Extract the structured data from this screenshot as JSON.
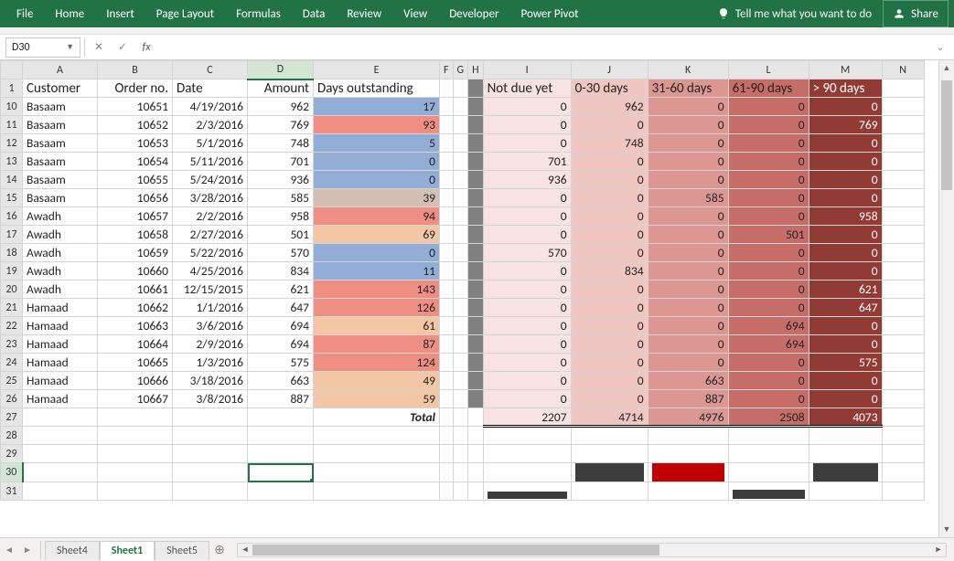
{
  "ribbon": {
    "tabs": [
      "File",
      "Home",
      "Insert",
      "Page Layout",
      "Formulas",
      "Data",
      "Review",
      "View",
      "Developer",
      "Power Pivot"
    ],
    "tellme": "Tell me what you want to do",
    "share": "Share"
  },
  "namebox": "D30",
  "cols": [
    "A",
    "B",
    "C",
    "D",
    "E",
    "F",
    "G",
    "H",
    "I",
    "J",
    "K",
    "L",
    "M",
    "N"
  ],
  "header_row": 1,
  "headers": {
    "A": "Customer",
    "B": "Order no.",
    "C": "Date",
    "D": "Amount",
    "E": "Days outstanding",
    "I": "Not due yet",
    "J": "0-30 days",
    "K": "31-60 days",
    "L": "61-90 days",
    "M": "> 90 days"
  },
  "rows": [
    {
      "n": 10,
      "A": "Basaam",
      "B": 10651,
      "C": "4/19/2016",
      "D": 962,
      "E": 17,
      "Ec": "e_low",
      "I": 0,
      "J": 962,
      "K": 0,
      "L": 0,
      "M": 0
    },
    {
      "n": 11,
      "A": "Basaam",
      "B": 10652,
      "C": "2/3/2016",
      "D": 769,
      "E": 93,
      "Ec": "e_high",
      "I": 0,
      "J": 0,
      "K": 0,
      "L": 0,
      "M": 769
    },
    {
      "n": 12,
      "A": "Basaam",
      "B": 10653,
      "C": "5/1/2016",
      "D": 748,
      "E": 5,
      "Ec": "e_low",
      "I": 0,
      "J": 748,
      "K": 0,
      "L": 0,
      "M": 0
    },
    {
      "n": 13,
      "A": "Basaam",
      "B": 10654,
      "C": "5/11/2016",
      "D": 701,
      "E": 0,
      "Ec": "e_low",
      "I": 701,
      "J": 0,
      "K": 0,
      "L": 0,
      "M": 0
    },
    {
      "n": 14,
      "A": "Basaam",
      "B": 10655,
      "C": "5/24/2016",
      "D": 936,
      "E": 0,
      "Ec": "e_low",
      "I": 936,
      "J": 0,
      "K": 0,
      "L": 0,
      "M": 0
    },
    {
      "n": 15,
      "A": "Basaam",
      "B": 10656,
      "C": "3/28/2016",
      "D": 585,
      "E": 39,
      "Ec": "e_mid1",
      "I": 0,
      "J": 0,
      "K": 585,
      "L": 0,
      "M": 0
    },
    {
      "n": 16,
      "A": "Awadh",
      "B": 10657,
      "C": "2/2/2016",
      "D": 958,
      "E": 94,
      "Ec": "e_high",
      "I": 0,
      "J": 0,
      "K": 0,
      "L": 0,
      "M": 958
    },
    {
      "n": 17,
      "A": "Awadh",
      "B": 10658,
      "C": "2/27/2016",
      "D": 501,
      "E": 69,
      "Ec": "e_mid2",
      "I": 0,
      "J": 0,
      "K": 0,
      "L": 501,
      "M": 0
    },
    {
      "n": 18,
      "A": "Awadh",
      "B": 10659,
      "C": "5/22/2016",
      "D": 570,
      "E": 0,
      "Ec": "e_low",
      "I": 570,
      "J": 0,
      "K": 0,
      "L": 0,
      "M": 0
    },
    {
      "n": 19,
      "A": "Awadh",
      "B": 10660,
      "C": "4/25/2016",
      "D": 834,
      "E": 11,
      "Ec": "e_low",
      "I": 0,
      "J": 834,
      "K": 0,
      "L": 0,
      "M": 0
    },
    {
      "n": 20,
      "A": "Awadh",
      "B": 10661,
      "C": "12/15/2015",
      "D": 621,
      "E": 143,
      "Ec": "e_high",
      "I": 0,
      "J": 0,
      "K": 0,
      "L": 0,
      "M": 621
    },
    {
      "n": 21,
      "A": "Hamaad",
      "B": 10662,
      "C": "1/1/2016",
      "D": 647,
      "E": 126,
      "Ec": "e_high",
      "I": 0,
      "J": 0,
      "K": 0,
      "L": 0,
      "M": 647
    },
    {
      "n": 22,
      "A": "Hamaad",
      "B": 10663,
      "C": "3/6/2016",
      "D": 694,
      "E": 61,
      "Ec": "e_mid2",
      "I": 0,
      "J": 0,
      "K": 0,
      "L": 694,
      "M": 0
    },
    {
      "n": 23,
      "A": "Hamaad",
      "B": 10664,
      "C": "2/9/2016",
      "D": 694,
      "E": 87,
      "Ec": "e_high",
      "I": 0,
      "J": 0,
      "K": 0,
      "L": 694,
      "M": 0
    },
    {
      "n": 24,
      "A": "Hamaad",
      "B": 10665,
      "C": "1/3/2016",
      "D": 575,
      "E": 124,
      "Ec": "e_high",
      "I": 0,
      "J": 0,
      "K": 0,
      "L": 0,
      "M": 575
    },
    {
      "n": 25,
      "A": "Hamaad",
      "B": 10666,
      "C": "3/18/2016",
      "D": 663,
      "E": 49,
      "Ec": "e_mid2",
      "I": 0,
      "J": 0,
      "K": 663,
      "L": 0,
      "M": 0
    },
    {
      "n": 26,
      "A": "Hamaad",
      "B": 10667,
      "C": "3/8/2016",
      "D": 887,
      "E": 59,
      "Ec": "e_mid2",
      "I": 0,
      "J": 0,
      "K": 887,
      "L": 0,
      "M": 0
    }
  ],
  "total": {
    "n": 27,
    "label": "Total",
    "I": 2207,
    "J": 4714,
    "K": 4976,
    "L": 2508,
    "M": 4073
  },
  "blank_rows": [
    28,
    29,
    30,
    31
  ],
  "selected_cell": {
    "row": 30,
    "col": "D"
  },
  "sheets": {
    "list": [
      "Sheet4",
      "Sheet1",
      "Sheet5"
    ],
    "active": "Sheet1"
  },
  "chart_data": {
    "type": "bar",
    "categories": [
      "Not due yet",
      "0-30 days",
      "31-60 days",
      "61-90 days",
      "> 90 days"
    ],
    "values": [
      2207,
      4714,
      4976,
      2508,
      4073
    ],
    "title": "",
    "xlabel": "",
    "ylabel": "",
    "ylim": [
      0,
      5000
    ]
  },
  "colwidths": {
    "A": 82,
    "B": 82,
    "C": 82,
    "D": 72,
    "E": 138,
    "F": 14,
    "G": 10,
    "H": 10,
    "I": 96,
    "J": 84,
    "K": 88,
    "L": 88,
    "M": 80,
    "N": 46
  }
}
